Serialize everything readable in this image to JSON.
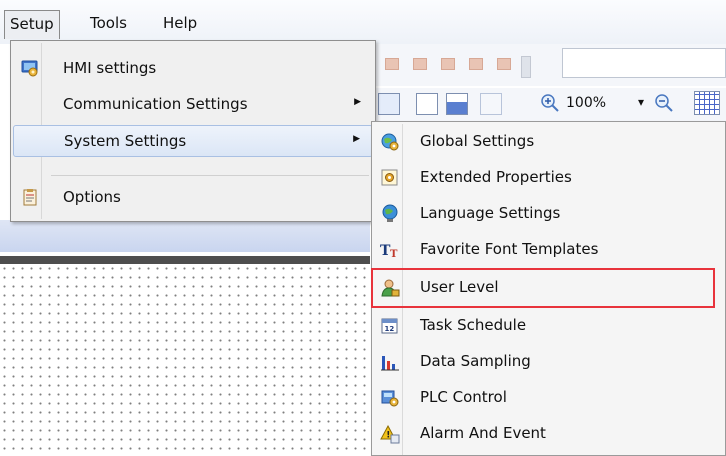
{
  "menubar": {
    "items": [
      {
        "label": "Setup",
        "open": true
      },
      {
        "label": "Tools"
      },
      {
        "label": "Help"
      }
    ]
  },
  "toolbar": {
    "zoom": "100%",
    "zoom_dropdown": "▾"
  },
  "setup_menu": {
    "items": [
      {
        "label": "HMI settings",
        "icon": "hmi-settings-icon"
      },
      {
        "label": "Communication Settings",
        "submenu_arrow": "▶"
      },
      {
        "label": "System Settings",
        "submenu_arrow": "▶",
        "hovered": true
      },
      {
        "label": "Options",
        "icon": "options-clipboard-icon"
      }
    ]
  },
  "system_settings_menu": {
    "items": [
      {
        "label": "Global Settings",
        "icon": "globe-gear-icon"
      },
      {
        "label": "Extended Properties",
        "icon": "extended-properties-icon"
      },
      {
        "label": "Language Settings",
        "icon": "language-globe-icon"
      },
      {
        "label": "Favorite Font Templates",
        "icon": "font-template-icon"
      },
      {
        "label": "User Level",
        "icon": "user-level-icon",
        "highlighted": true
      },
      {
        "label": "Task Schedule",
        "icon": "calendar-icon",
        "icon_text": "12"
      },
      {
        "label": "Data Sampling",
        "icon": "bar-chart-icon"
      },
      {
        "label": "PLC Control",
        "icon": "plc-control-icon"
      },
      {
        "label": "Alarm And Event",
        "icon": "alarm-warning-icon"
      }
    ]
  },
  "colors": {
    "highlight_outline": "#e8333c",
    "menu_background": "#f0f0f0",
    "hover_background": "#dbe6f6"
  }
}
